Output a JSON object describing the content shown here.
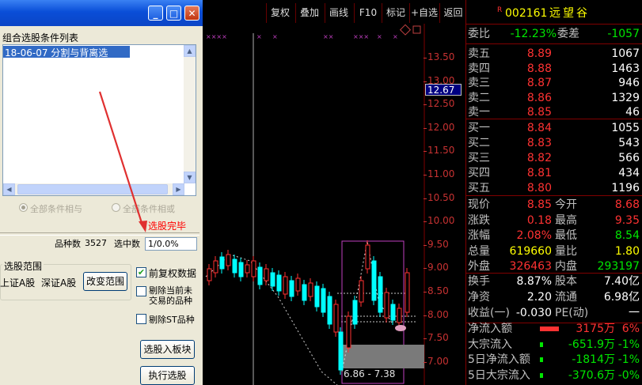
{
  "window": {
    "buttons": [
      "_",
      "□",
      "✕"
    ]
  },
  "dialog": {
    "condition_list_title": "组合选股条件列表",
    "condition_items": [
      "18-06-07 分割与背离选"
    ],
    "radio_all_and": "全部条件相与",
    "radio_all_or": "全部条件相或",
    "status": "选股完毕",
    "count_label": "品种数",
    "count_value": "3527",
    "selected_label": "选中数",
    "selected_value": "1/0.0%",
    "range_group_label": "选股范围",
    "range_value_1": "上证A股",
    "range_value_2": "深证A股",
    "change_range_button": "改变范围",
    "option_pre_adjust": "前复权数据",
    "option_pre_adjust_checked": true,
    "option_exclude_new": "剔除当前未交易的品种",
    "option_exclude_new_checked": false,
    "option_exclude_st": "剔除ST品种",
    "option_exclude_st_checked": false,
    "to_board_button": "选股入板块",
    "execute_button": "执行选股"
  },
  "chart": {
    "toolbar": [
      "复权",
      "叠加",
      "画线",
      "F10",
      "标记",
      "+自选",
      "返回"
    ],
    "y_ticks": [
      "13.50",
      "13.00",
      "12.50",
      "12.00",
      "11.50",
      "11.00",
      "10.50",
      "10.00",
      "9.50",
      "9.00",
      "8.50",
      "8.00",
      "7.50",
      "7.00"
    ],
    "current_price_tag": "12.67",
    "range_label": "6.86 - 7.38",
    "colors": {
      "up": "#ff3232",
      "down": "#00ffff",
      "axis": "#c83232",
      "background": "#000000"
    }
  },
  "quote": {
    "badge": "R",
    "stock_code": "002161",
    "stock_name": "远望谷",
    "wei_bi_label": "委比",
    "wei_bi_value": "-12.23%",
    "wei_cha_label": "委差",
    "wei_cha_value": "-1057",
    "asks": [
      {
        "label": "卖五",
        "price": "8.89",
        "vol": "1067"
      },
      {
        "label": "卖四",
        "price": "8.88",
        "vol": "1463"
      },
      {
        "label": "卖三",
        "price": "8.87",
        "vol": "946"
      },
      {
        "label": "卖二",
        "price": "8.86",
        "vol": "1329"
      },
      {
        "label": "卖一",
        "price": "8.85",
        "vol": "46"
      }
    ],
    "bids": [
      {
        "label": "买一",
        "price": "8.84",
        "vol": "1055"
      },
      {
        "label": "买二",
        "price": "8.83",
        "vol": "543"
      },
      {
        "label": "买三",
        "price": "8.82",
        "vol": "566"
      },
      {
        "label": "买四",
        "price": "8.81",
        "vol": "434"
      },
      {
        "label": "买五",
        "price": "8.80",
        "vol": "1196"
      }
    ],
    "stats": [
      {
        "l1": "现价",
        "v1": "8.85",
        "l2": "今开",
        "v2": "8.68"
      },
      {
        "l1": "涨跌",
        "v1": "0.18",
        "l2": "最高",
        "v2": "9.35"
      },
      {
        "l1": "涨幅",
        "v1": "2.08%",
        "l2": "最低",
        "v2": "8.54"
      },
      {
        "l1": "总量",
        "v1": "619660",
        "l2": "量比",
        "v2": "1.80"
      },
      {
        "l1": "外盘",
        "v1": "326463",
        "l2": "内盘",
        "v2": "293197"
      }
    ],
    "stats2": [
      {
        "l1": "换手",
        "v1": "8.87%",
        "l2": "股本",
        "v2": "7.40亿"
      },
      {
        "l1": "净资",
        "v1": "2.20",
        "l2": "流通",
        "v2": "6.98亿"
      },
      {
        "l1": "收益(一)",
        "v1": "-0.030",
        "l2": "PE(动)",
        "v2": "一"
      }
    ],
    "flows": [
      {
        "label": "净流入额",
        "value": "3175万",
        "pct": "6%"
      },
      {
        "label": "大宗流入",
        "value": "-651.9万",
        "pct": "-1%"
      },
      {
        "label": "5日净流入额",
        "value": "-1814万",
        "pct": "-1%"
      },
      {
        "label": "5日大宗流入",
        "value": "-370.6万",
        "pct": "-0%"
      }
    ]
  }
}
